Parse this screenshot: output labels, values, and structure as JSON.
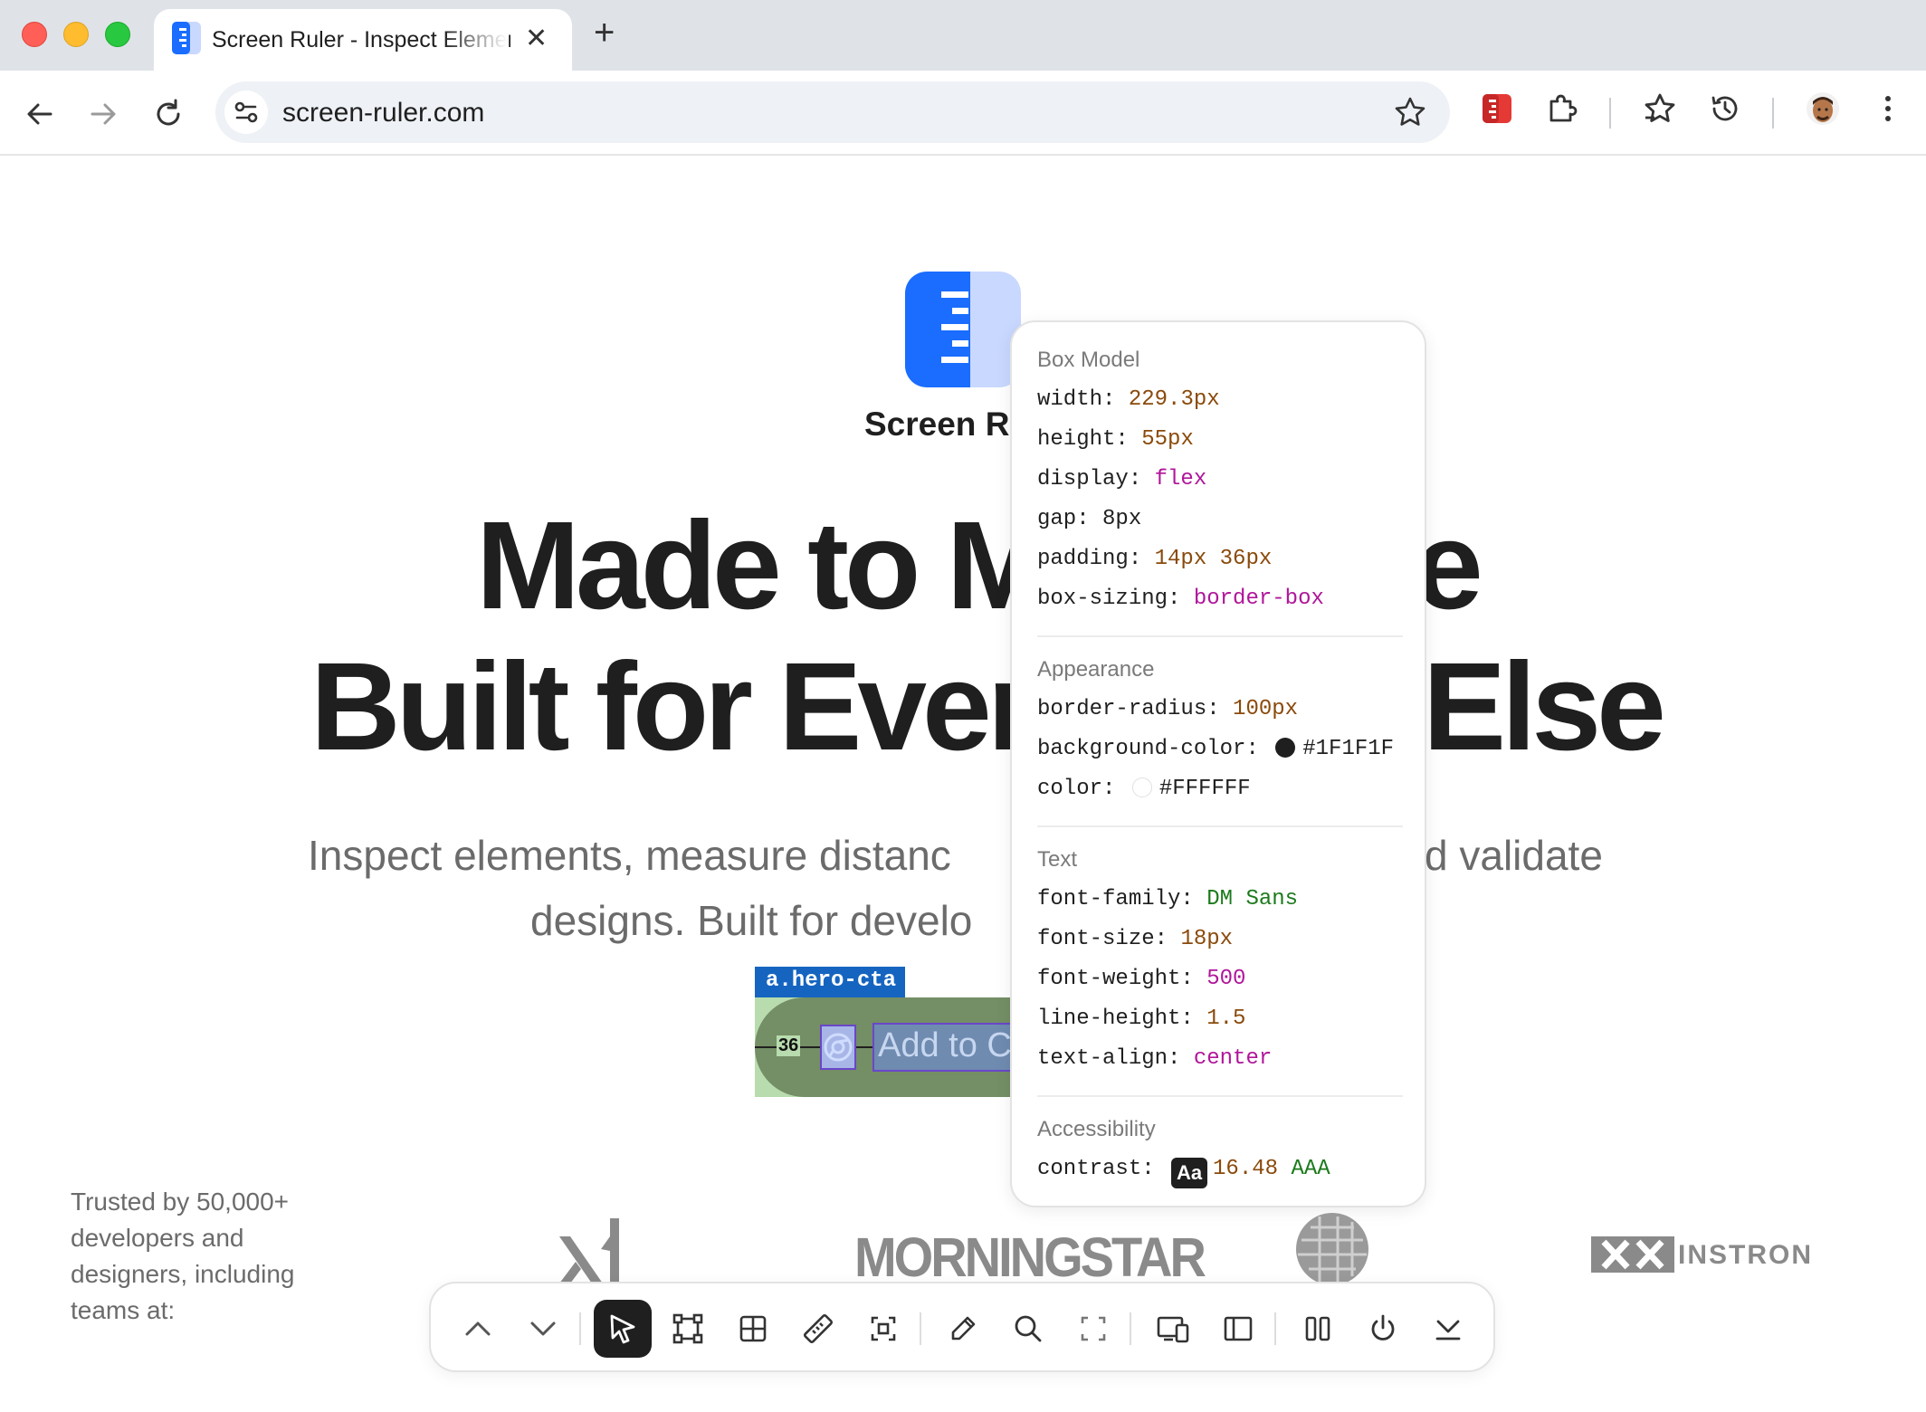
{
  "browser": {
    "tab_title": "Screen Ruler - Inspect Element",
    "url": "screen-ruler.com"
  },
  "page": {
    "brand_name": "Screen Ruler",
    "hero_line1_left": "Made to M",
    "hero_line1_right": "e",
    "hero_line2_left": "Built for Ever",
    "hero_line2_right": "Else",
    "sub_line1_left": "Inspect elements, measure distanc",
    "sub_line1_right": "d validate",
    "sub_line2": "designs. Built for develo",
    "cta_text": "Add to Ch",
    "trusted_text": "Trusted by 50,000+ developers and designers, including teams at:",
    "logos": [
      "MORNINGSTAR",
      "INSTRON"
    ]
  },
  "inspector": {
    "element_label": "a.hero-cta",
    "padding_measure": "36"
  },
  "panel": {
    "box_model": {
      "title": "Box Model",
      "props": [
        {
          "name": "width:",
          "value": "229.3px",
          "kind": "num"
        },
        {
          "name": "height:",
          "value": "55px",
          "kind": "num"
        },
        {
          "name": "display:",
          "value": "flex",
          "kind": "kw"
        },
        {
          "name": "gap:",
          "value": "8px",
          "kind": "plain"
        },
        {
          "name": "padding:",
          "value": "14px 36px",
          "kind": "num"
        },
        {
          "name": "box-sizing:",
          "value": "border-box",
          "kind": "kw"
        }
      ]
    },
    "appearance": {
      "title": "Appearance",
      "border_radius_name": "border-radius:",
      "border_radius_value": "100px",
      "bg_name": "background-color:",
      "bg_value": "#1F1F1F",
      "color_name": "color:",
      "color_value": "#FFFFFF"
    },
    "text": {
      "title": "Text",
      "props": [
        {
          "name": "font-family:",
          "value": "DM Sans",
          "kind": "str"
        },
        {
          "name": "font-size:",
          "value": "18px",
          "kind": "num"
        },
        {
          "name": "font-weight:",
          "value": "500",
          "kind": "kw"
        },
        {
          "name": "line-height:",
          "value": "1.5",
          "kind": "num"
        },
        {
          "name": "text-align:",
          "value": "center",
          "kind": "kw"
        }
      ]
    },
    "accessibility": {
      "title": "Accessibility",
      "contrast_name": "contrast:",
      "badge": "Aa",
      "ratio": "16.48",
      "level": "AAA"
    }
  },
  "colors": {
    "accent_blue": "#1a6dff",
    "dark": "#1F1F1F",
    "white": "#FFFFFF"
  },
  "dock_tools": [
    "chevron-up-icon",
    "chevron-down-icon",
    "pointer-icon",
    "bounding-box-icon",
    "grid-icon",
    "ruler-icon",
    "focus-icon",
    "eyedropper-icon",
    "magnifier-icon",
    "expand-icon",
    "responsive-icon",
    "sidebar-icon",
    "columns-icon",
    "power-icon",
    "collapse-icon"
  ]
}
